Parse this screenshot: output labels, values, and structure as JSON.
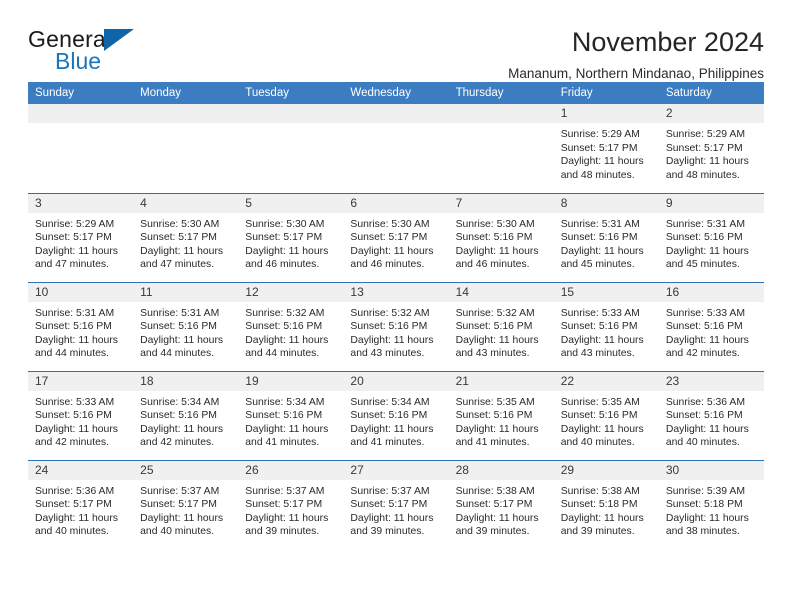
{
  "brand": {
    "name_part1": "General",
    "name_part2": "Blue",
    "logo_icon": "triangle-flag-icon"
  },
  "header": {
    "title": "November 2024",
    "subtitle": "Mananum, Northern Mindanao, Philippines"
  },
  "colors": {
    "header_band": "#3b7dc0",
    "row_divider": "#2f6fb0",
    "daynum_band": "#f0f0f0",
    "brand_blue": "#1b75bb"
  },
  "calendar": {
    "weekday_headers": [
      "Sunday",
      "Monday",
      "Tuesday",
      "Wednesday",
      "Thursday",
      "Friday",
      "Saturday"
    ],
    "weeks": [
      [
        {
          "day": "",
          "sunrise": "",
          "sunset": "",
          "daylight": "",
          "empty": true
        },
        {
          "day": "",
          "sunrise": "",
          "sunset": "",
          "daylight": "",
          "empty": true
        },
        {
          "day": "",
          "sunrise": "",
          "sunset": "",
          "daylight": "",
          "empty": true
        },
        {
          "day": "",
          "sunrise": "",
          "sunset": "",
          "daylight": "",
          "empty": true
        },
        {
          "day": "",
          "sunrise": "",
          "sunset": "",
          "daylight": "",
          "empty": true
        },
        {
          "day": "1",
          "sunrise": "Sunrise: 5:29 AM",
          "sunset": "Sunset: 5:17 PM",
          "daylight": "Daylight: 11 hours and 48 minutes.",
          "empty": false
        },
        {
          "day": "2",
          "sunrise": "Sunrise: 5:29 AM",
          "sunset": "Sunset: 5:17 PM",
          "daylight": "Daylight: 11 hours and 48 minutes.",
          "empty": false
        }
      ],
      [
        {
          "day": "3",
          "sunrise": "Sunrise: 5:29 AM",
          "sunset": "Sunset: 5:17 PM",
          "daylight": "Daylight: 11 hours and 47 minutes.",
          "empty": false
        },
        {
          "day": "4",
          "sunrise": "Sunrise: 5:30 AM",
          "sunset": "Sunset: 5:17 PM",
          "daylight": "Daylight: 11 hours and 47 minutes.",
          "empty": false
        },
        {
          "day": "5",
          "sunrise": "Sunrise: 5:30 AM",
          "sunset": "Sunset: 5:17 PM",
          "daylight": "Daylight: 11 hours and 46 minutes.",
          "empty": false
        },
        {
          "day": "6",
          "sunrise": "Sunrise: 5:30 AM",
          "sunset": "Sunset: 5:17 PM",
          "daylight": "Daylight: 11 hours and 46 minutes.",
          "empty": false
        },
        {
          "day": "7",
          "sunrise": "Sunrise: 5:30 AM",
          "sunset": "Sunset: 5:16 PM",
          "daylight": "Daylight: 11 hours and 46 minutes.",
          "empty": false
        },
        {
          "day": "8",
          "sunrise": "Sunrise: 5:31 AM",
          "sunset": "Sunset: 5:16 PM",
          "daylight": "Daylight: 11 hours and 45 minutes.",
          "empty": false
        },
        {
          "day": "9",
          "sunrise": "Sunrise: 5:31 AM",
          "sunset": "Sunset: 5:16 PM",
          "daylight": "Daylight: 11 hours and 45 minutes.",
          "empty": false
        }
      ],
      [
        {
          "day": "10",
          "sunrise": "Sunrise: 5:31 AM",
          "sunset": "Sunset: 5:16 PM",
          "daylight": "Daylight: 11 hours and 44 minutes.",
          "empty": false
        },
        {
          "day": "11",
          "sunrise": "Sunrise: 5:31 AM",
          "sunset": "Sunset: 5:16 PM",
          "daylight": "Daylight: 11 hours and 44 minutes.",
          "empty": false
        },
        {
          "day": "12",
          "sunrise": "Sunrise: 5:32 AM",
          "sunset": "Sunset: 5:16 PM",
          "daylight": "Daylight: 11 hours and 44 minutes.",
          "empty": false
        },
        {
          "day": "13",
          "sunrise": "Sunrise: 5:32 AM",
          "sunset": "Sunset: 5:16 PM",
          "daylight": "Daylight: 11 hours and 43 minutes.",
          "empty": false
        },
        {
          "day": "14",
          "sunrise": "Sunrise: 5:32 AM",
          "sunset": "Sunset: 5:16 PM",
          "daylight": "Daylight: 11 hours and 43 minutes.",
          "empty": false
        },
        {
          "day": "15",
          "sunrise": "Sunrise: 5:33 AM",
          "sunset": "Sunset: 5:16 PM",
          "daylight": "Daylight: 11 hours and 43 minutes.",
          "empty": false
        },
        {
          "day": "16",
          "sunrise": "Sunrise: 5:33 AM",
          "sunset": "Sunset: 5:16 PM",
          "daylight": "Daylight: 11 hours and 42 minutes.",
          "empty": false
        }
      ],
      [
        {
          "day": "17",
          "sunrise": "Sunrise: 5:33 AM",
          "sunset": "Sunset: 5:16 PM",
          "daylight": "Daylight: 11 hours and 42 minutes.",
          "empty": false
        },
        {
          "day": "18",
          "sunrise": "Sunrise: 5:34 AM",
          "sunset": "Sunset: 5:16 PM",
          "daylight": "Daylight: 11 hours and 42 minutes.",
          "empty": false
        },
        {
          "day": "19",
          "sunrise": "Sunrise: 5:34 AM",
          "sunset": "Sunset: 5:16 PM",
          "daylight": "Daylight: 11 hours and 41 minutes.",
          "empty": false
        },
        {
          "day": "20",
          "sunrise": "Sunrise: 5:34 AM",
          "sunset": "Sunset: 5:16 PM",
          "daylight": "Daylight: 11 hours and 41 minutes.",
          "empty": false
        },
        {
          "day": "21",
          "sunrise": "Sunrise: 5:35 AM",
          "sunset": "Sunset: 5:16 PM",
          "daylight": "Daylight: 11 hours and 41 minutes.",
          "empty": false
        },
        {
          "day": "22",
          "sunrise": "Sunrise: 5:35 AM",
          "sunset": "Sunset: 5:16 PM",
          "daylight": "Daylight: 11 hours and 40 minutes.",
          "empty": false
        },
        {
          "day": "23",
          "sunrise": "Sunrise: 5:36 AM",
          "sunset": "Sunset: 5:16 PM",
          "daylight": "Daylight: 11 hours and 40 minutes.",
          "empty": false
        }
      ],
      [
        {
          "day": "24",
          "sunrise": "Sunrise: 5:36 AM",
          "sunset": "Sunset: 5:17 PM",
          "daylight": "Daylight: 11 hours and 40 minutes.",
          "empty": false
        },
        {
          "day": "25",
          "sunrise": "Sunrise: 5:37 AM",
          "sunset": "Sunset: 5:17 PM",
          "daylight": "Daylight: 11 hours and 40 minutes.",
          "empty": false
        },
        {
          "day": "26",
          "sunrise": "Sunrise: 5:37 AM",
          "sunset": "Sunset: 5:17 PM",
          "daylight": "Daylight: 11 hours and 39 minutes.",
          "empty": false
        },
        {
          "day": "27",
          "sunrise": "Sunrise: 5:37 AM",
          "sunset": "Sunset: 5:17 PM",
          "daylight": "Daylight: 11 hours and 39 minutes.",
          "empty": false
        },
        {
          "day": "28",
          "sunrise": "Sunrise: 5:38 AM",
          "sunset": "Sunset: 5:17 PM",
          "daylight": "Daylight: 11 hours and 39 minutes.",
          "empty": false
        },
        {
          "day": "29",
          "sunrise": "Sunrise: 5:38 AM",
          "sunset": "Sunset: 5:18 PM",
          "daylight": "Daylight: 11 hours and 39 minutes.",
          "empty": false
        },
        {
          "day": "30",
          "sunrise": "Sunrise: 5:39 AM",
          "sunset": "Sunset: 5:18 PM",
          "daylight": "Daylight: 11 hours and 38 minutes.",
          "empty": false
        }
      ]
    ]
  }
}
